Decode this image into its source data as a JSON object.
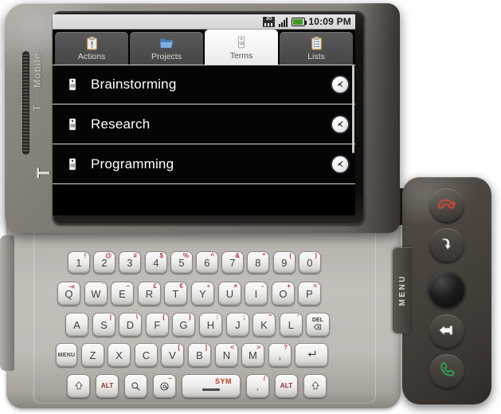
{
  "device": {
    "brand_text": "T · ·Mobile·",
    "brand_logo": "T",
    "menu_label": "MENU",
    "buttons": [
      {
        "name": "end-call-button",
        "icon": "phone-hangup-icon",
        "color": "#c0392b"
      },
      {
        "name": "home-button",
        "icon": "home-arrow-icon",
        "color": "#ffffff"
      },
      {
        "name": "trackball",
        "icon": "trackball-icon",
        "color": "#111111"
      },
      {
        "name": "back-button",
        "icon": "back-arrow-icon",
        "color": "#ffffff"
      },
      {
        "name": "call-button",
        "icon": "phone-call-icon",
        "color": "#27ae60"
      }
    ]
  },
  "screen": {
    "statusbar": {
      "time": "10:09 PM",
      "network_label": "3G",
      "signal_bars": 4,
      "battery_level": "full"
    },
    "tabs": [
      {
        "label": "Actions",
        "icon": "clipboard-exclamation-icon",
        "active": false
      },
      {
        "label": "Projects",
        "icon": "folder-icon",
        "active": false
      },
      {
        "label": "Terms",
        "icon": "tag-icon",
        "active": true
      },
      {
        "label": "Lists",
        "icon": "clipboard-list-icon",
        "active": false
      }
    ],
    "list": {
      "items": [
        {
          "label": "Brainstorming",
          "icon": "tag-icon",
          "action_icon": "arrow-go-icon"
        },
        {
          "label": "Research",
          "icon": "tag-icon",
          "action_icon": "arrow-go-icon"
        },
        {
          "label": "Programming",
          "icon": "tag-icon",
          "action_icon": "arrow-go-icon"
        }
      ]
    }
  },
  "keyboard": {
    "rows": [
      [
        {
          "main": "1",
          "alt": "!"
        },
        {
          "main": "2",
          "alt": "@"
        },
        {
          "main": "3",
          "alt": "#"
        },
        {
          "main": "4",
          "alt": "$"
        },
        {
          "main": "5",
          "alt": "%"
        },
        {
          "main": "6",
          "alt": "^"
        },
        {
          "main": "7",
          "alt": "&"
        },
        {
          "main": "8",
          "alt": "*"
        },
        {
          "main": "9",
          "alt": "("
        },
        {
          "main": "0",
          "alt": ")"
        }
      ],
      [
        {
          "main": "Q",
          "alt": "→|"
        },
        {
          "main": "W",
          "alt": "`"
        },
        {
          "main": "E",
          "alt": "−"
        },
        {
          "main": "R",
          "alt": "£"
        },
        {
          "main": "T",
          "alt": "€"
        },
        {
          "main": "Y",
          "alt": "÷"
        },
        {
          "main": "U",
          "alt": "×"
        },
        {
          "main": "I",
          "alt": "-"
        },
        {
          "main": "O",
          "alt": "+"
        },
        {
          "main": "P",
          "alt": "="
        }
      ],
      [
        {
          "main": "A",
          "alt": ""
        },
        {
          "main": "S",
          "alt": "|"
        },
        {
          "main": "D",
          "alt": "\\"
        },
        {
          "main": "F",
          "alt": "{"
        },
        {
          "main": "G",
          "alt": "}"
        },
        {
          "main": "H",
          "alt": ":"
        },
        {
          "main": "J",
          "alt": ";"
        },
        {
          "main": "K",
          "alt": "\""
        },
        {
          "main": "L",
          "alt": "'"
        },
        {
          "main": "DEL",
          "alt": ""
        }
      ],
      [
        {
          "main": "MENU",
          "alt": ""
        },
        {
          "main": "Z",
          "alt": ""
        },
        {
          "main": "X",
          "alt": ""
        },
        {
          "main": "C",
          "alt": ""
        },
        {
          "main": "V",
          "alt": "["
        },
        {
          "main": "B",
          "alt": "]"
        },
        {
          "main": "N",
          "alt": "<"
        },
        {
          "main": "M",
          "alt": ">"
        },
        {
          "main": ",",
          "alt": "?"
        },
        {
          "main": "↵",
          "alt": ""
        }
      ],
      [
        {
          "main": "shift",
          "alt": ""
        },
        {
          "main": "ALT",
          "alt": ""
        },
        {
          "main": "search",
          "alt": ""
        },
        {
          "main": "@",
          "alt": "~"
        },
        {
          "main": "space",
          "alt": "SYM"
        },
        {
          "main": ".",
          "alt": "/"
        },
        {
          "main": "ALT",
          "alt": ""
        },
        {
          "main": "shift",
          "alt": ""
        }
      ]
    ],
    "space_sym_label": "SYM",
    "del_label": "DEL",
    "menu_key_label": "MENU",
    "alt_key_label": "ALT"
  }
}
